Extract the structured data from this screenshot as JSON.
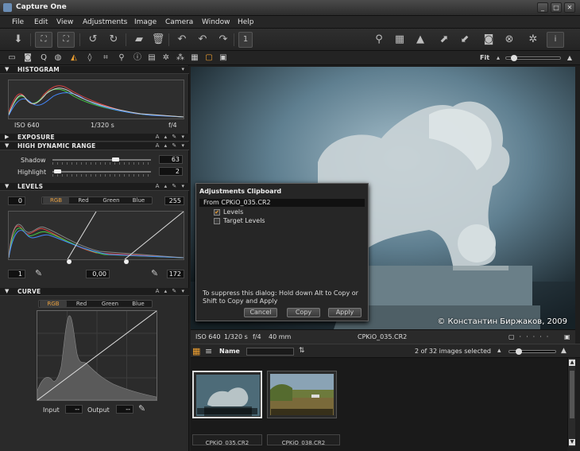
{
  "window": {
    "title": "Capture One"
  },
  "menu": [
    "File",
    "Edit",
    "View",
    "Adjustments",
    "Image",
    "Camera",
    "Window",
    "Help"
  ],
  "toolbar": {
    "counter": "1"
  },
  "tool_tabs": {
    "zoom_label": "Fit"
  },
  "histogram": {
    "header": "HISTOGRAM",
    "iso": "ISO 640",
    "shutter": "1/320 s",
    "aperture": "f/4"
  },
  "exposure": {
    "header": "EXPOSURE"
  },
  "hdr": {
    "header": "HIGH DYNAMIC RANGE",
    "shadow_label": "Shadow",
    "shadow_value": "63",
    "highlight_label": "Highlight",
    "highlight_value": "2"
  },
  "levels": {
    "header": "LEVELS",
    "channels": [
      "RGB",
      "Red",
      "Green",
      "Blue"
    ],
    "input_low": "0",
    "input_high": "255",
    "output_low": "1",
    "midtone": "0,00",
    "output_high": "172"
  },
  "curve": {
    "header": "CURVE",
    "channels": [
      "RGB",
      "Red",
      "Green",
      "Blue"
    ],
    "input_label": "Input",
    "output_label": "Output",
    "input_value": "--",
    "output_value": "--"
  },
  "panel_header_controls": "A ▴ ✎ ▾",
  "dialog": {
    "title": "Adjustments Clipboard",
    "source": "From CPKiO_035.CR2",
    "items": [
      {
        "label": "Levels",
        "checked": "✔"
      },
      {
        "label": "Target Levels",
        "checked": ""
      }
    ],
    "note": "To suppress this dialog: Hold down Alt to Copy or Shift to Copy and Apply",
    "cancel": "Cancel",
    "copy": "Copy",
    "apply": "Apply"
  },
  "viewer": {
    "copyright": "© Константин Биржаков, 2009",
    "iso": "ISO 640",
    "shutter": "1/320 s",
    "aperture": "f/4",
    "focal": "40 mm",
    "filename": "CPKiO_035.CR2"
  },
  "browser": {
    "sort_label": "Name",
    "count": "2 of 32 images selected",
    "captions": [
      "CPKiO_035.CR2",
      "CPKiO_038.CR2"
    ]
  },
  "colors": {
    "accent": "#f0a030",
    "viewer_sky": "#6e8fa0"
  }
}
